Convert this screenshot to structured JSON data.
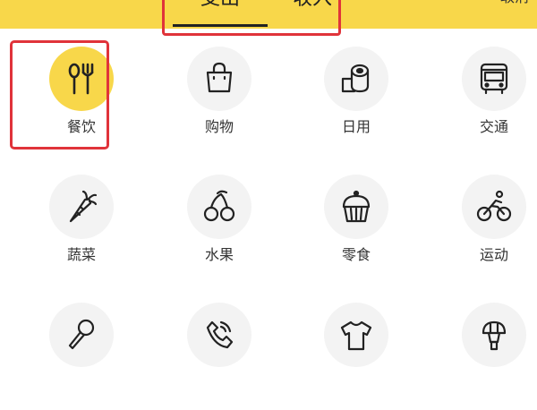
{
  "header": {
    "tabs": [
      {
        "label": "支出",
        "selected": true
      },
      {
        "label": "收入",
        "selected": false
      }
    ],
    "cancel_label": "取消",
    "accent_color": "#f8d74a",
    "highlight_color": "#e0333a"
  },
  "categories": [
    {
      "label": "餐饮",
      "icon": "utensils-icon",
      "selected": true
    },
    {
      "label": "购物",
      "icon": "shopping-bag-icon",
      "selected": false
    },
    {
      "label": "日用",
      "icon": "toilet-paper-icon",
      "selected": false
    },
    {
      "label": "交通",
      "icon": "bus-icon",
      "selected": false
    },
    {
      "label": "蔬菜",
      "icon": "carrot-icon",
      "selected": false
    },
    {
      "label": "水果",
      "icon": "cherries-icon",
      "selected": false
    },
    {
      "label": "零食",
      "icon": "cupcake-icon",
      "selected": false
    },
    {
      "label": "运动",
      "icon": "cycling-icon",
      "selected": false
    },
    {
      "label": "",
      "icon": "microphone-icon",
      "selected": false
    },
    {
      "label": "",
      "icon": "phone-icon",
      "selected": false
    },
    {
      "label": "",
      "icon": "tshirt-icon",
      "selected": false
    },
    {
      "label": "",
      "icon": "makeup-brush-icon",
      "selected": false
    }
  ]
}
